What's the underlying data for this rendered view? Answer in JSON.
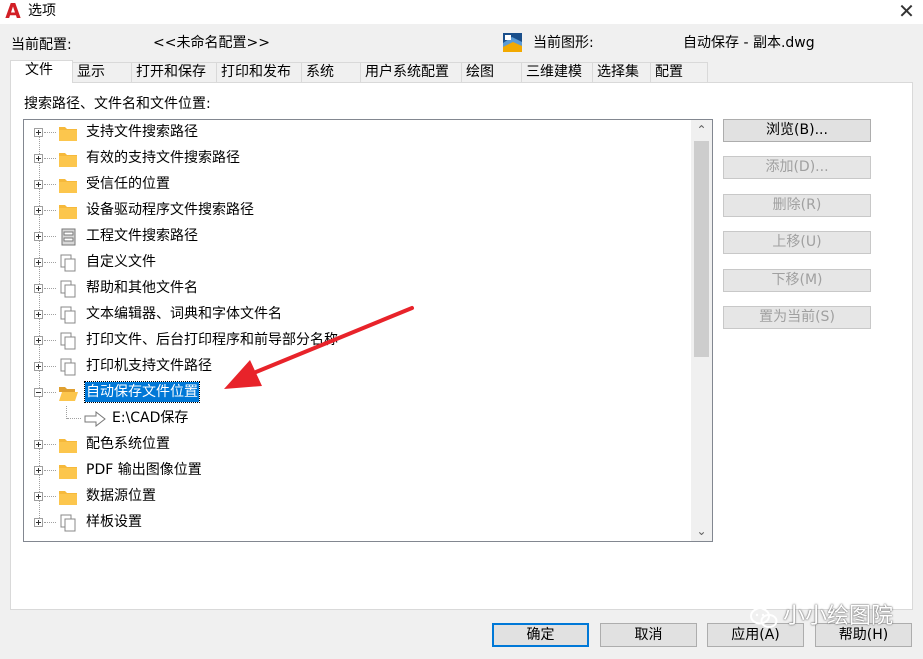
{
  "window": {
    "title": "选项",
    "close_glyph": "✕",
    "app_logo": "A"
  },
  "profile": {
    "current_profile_label": "当前配置:",
    "current_profile_value": "<<未命名配置>>",
    "current_drawing_label": "当前图形:",
    "current_drawing_value": "自动保存 - 副本.dwg"
  },
  "tabs": [
    {
      "label": "文件",
      "active": true
    },
    {
      "label": "显示"
    },
    {
      "label": "打开和保存"
    },
    {
      "label": "打印和发布"
    },
    {
      "label": "系统"
    },
    {
      "label": "用户系统配置"
    },
    {
      "label": "绘图"
    },
    {
      "label": "三维建模"
    },
    {
      "label": "选择集"
    },
    {
      "label": "配置"
    }
  ],
  "panel": {
    "label": "搜索路径、文件名和文件位置:"
  },
  "tree": {
    "items": [
      {
        "label": "支持文件搜索路径",
        "icon": "folder-icon"
      },
      {
        "label": "有效的支持文件搜索路径",
        "icon": "folder-icon"
      },
      {
        "label": "受信任的位置",
        "icon": "folder-icon"
      },
      {
        "label": "设备驱动程序文件搜索路径",
        "icon": "folder-icon"
      },
      {
        "label": "工程文件搜索路径",
        "icon": "project-cabinet-icon"
      },
      {
        "label": "自定义文件",
        "icon": "files-icon"
      },
      {
        "label": "帮助和其他文件名",
        "icon": "files-icon"
      },
      {
        "label": "文本编辑器、词典和字体文件名",
        "icon": "files-icon"
      },
      {
        "label": "打印文件、后台打印程序和前导部分名称",
        "icon": "files-icon"
      },
      {
        "label": "打印机支持文件路径",
        "icon": "files-icon"
      },
      {
        "label": "自动保存文件位置",
        "icon": "folder-open-icon",
        "selected": true,
        "expanded": true
      },
      {
        "label": "配色系统位置",
        "icon": "folder-icon"
      },
      {
        "label": "PDF 输出图像位置",
        "icon": "folder-icon"
      },
      {
        "label": "数据源位置",
        "icon": "folder-icon"
      },
      {
        "label": "样板设置",
        "icon": "files-icon"
      }
    ],
    "autosave_child": {
      "label": "E:\\CAD保存",
      "icon": "arrow-right-icon"
    },
    "scroll_position": 0
  },
  "side_buttons": {
    "browse": "浏览(B)...",
    "add": "添加(D)...",
    "remove": "删除(R)",
    "move_up": "上移(U)",
    "move_down": "下移(M)",
    "set_current": "置为当前(S)"
  },
  "bottom_buttons": {
    "ok": "确定",
    "cancel": "取消",
    "apply": "应用(A)",
    "help": "帮助(H)"
  },
  "watermark": {
    "text": "小小绘图院"
  },
  "colors": {
    "selection": "#0078d7",
    "annotation_arrow": "#e8232a",
    "folder": "#f6b93b"
  }
}
